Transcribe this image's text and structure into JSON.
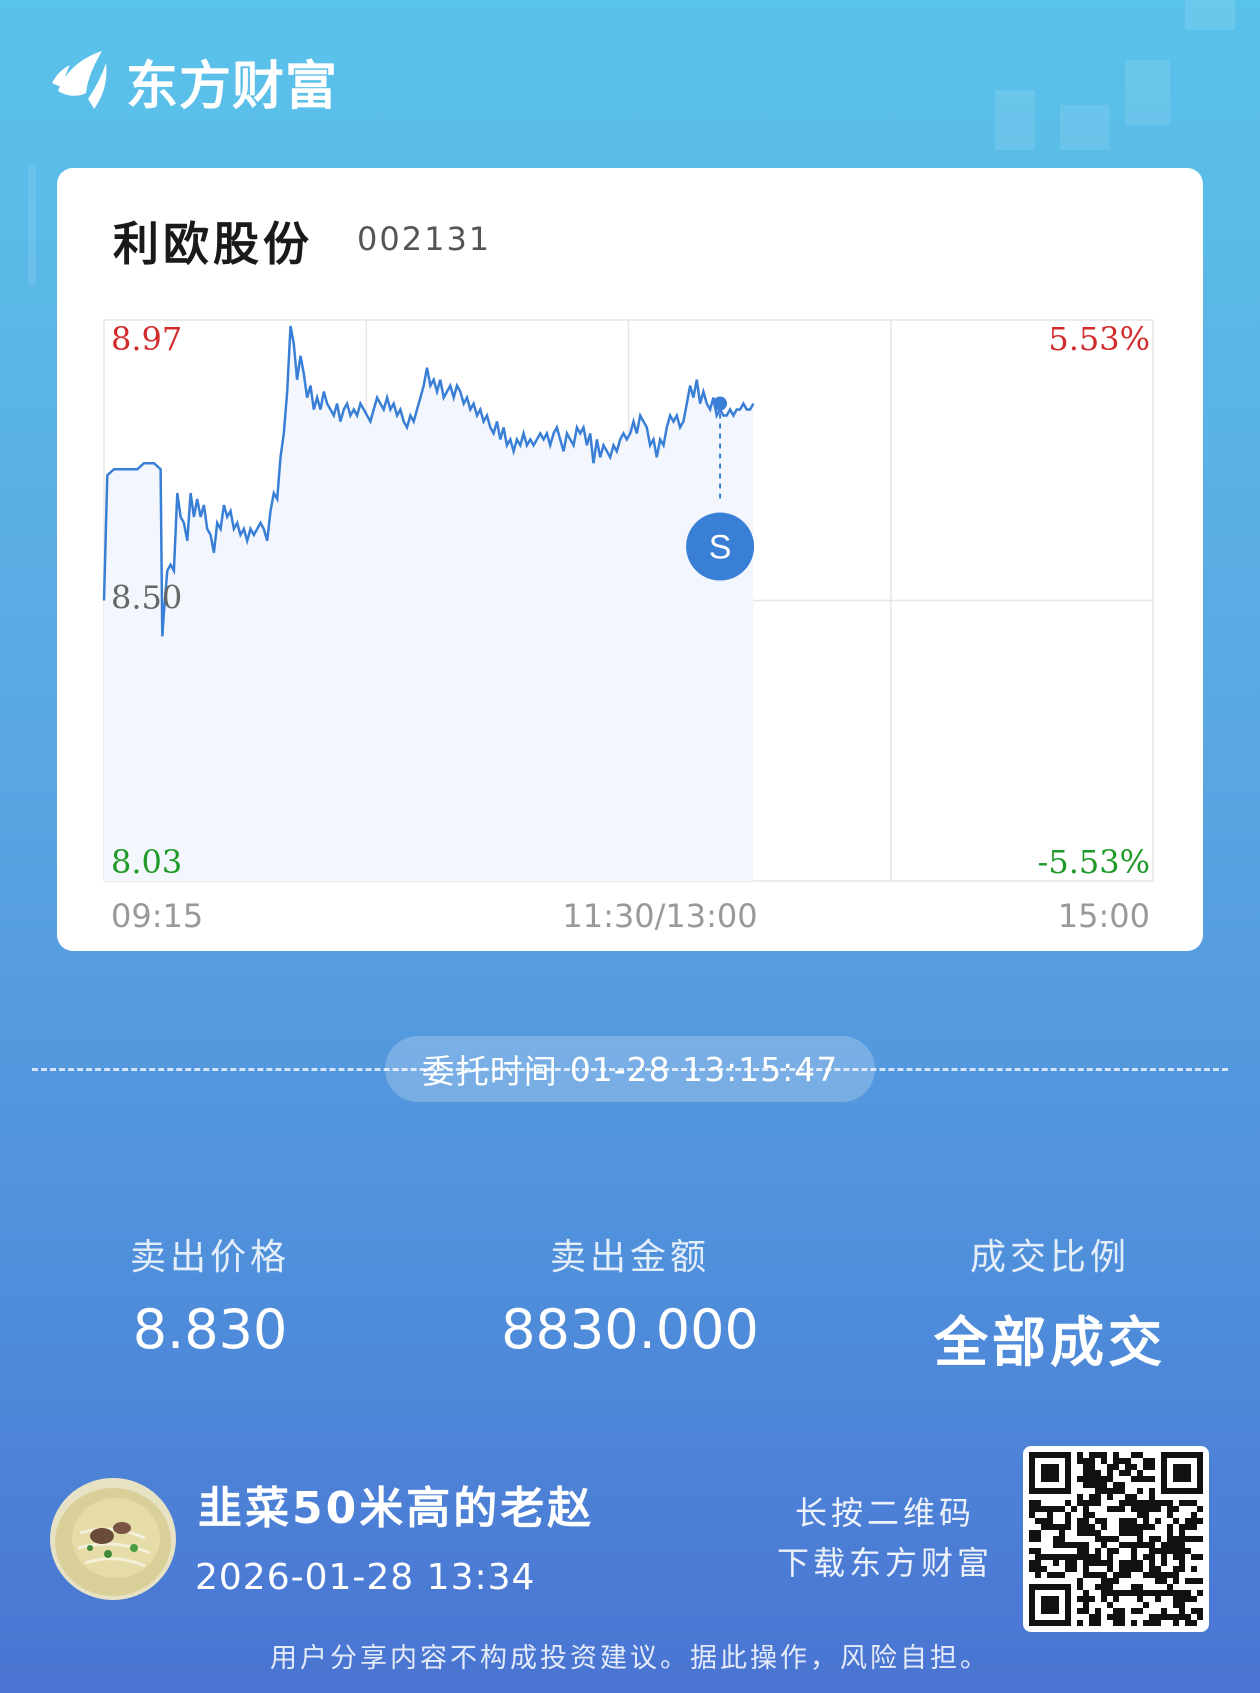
{
  "brand": {
    "name": "东方财富"
  },
  "stock": {
    "name": "利欧股份",
    "code": "002131"
  },
  "chart_data": {
    "type": "line",
    "y_labels": {
      "top": "8.97",
      "mid": "8.50",
      "bottom": "8.03"
    },
    "pct_labels": {
      "top": "5.53%",
      "bottom": "-5.53%"
    },
    "x_labels": {
      "start": "09:15",
      "mid": "11:30/13:00",
      "end": "15:00"
    },
    "ylim": [
      8.03,
      8.97
    ],
    "marker": {
      "label": "S",
      "time": "13:15",
      "price": 8.83
    },
    "series": [
      {
        "values": [
          [
            0,
            8.5
          ],
          [
            1,
            8.71
          ],
          [
            3,
            8.72
          ],
          [
            5,
            8.72
          ],
          [
            7,
            8.72
          ],
          [
            10,
            8.72
          ],
          [
            12,
            8.73
          ],
          [
            15,
            8.73
          ],
          [
            17,
            8.72
          ],
          [
            17.5,
            8.44
          ],
          [
            18,
            8.48
          ],
          [
            19,
            8.55
          ],
          [
            20,
            8.56
          ],
          [
            21,
            8.55
          ],
          [
            22,
            8.68
          ],
          [
            23,
            8.64
          ],
          [
            24,
            8.63
          ],
          [
            25,
            8.6
          ],
          [
            26,
            8.68
          ],
          [
            27,
            8.64
          ],
          [
            28,
            8.67
          ],
          [
            29,
            8.64
          ],
          [
            30,
            8.66
          ],
          [
            31,
            8.62
          ],
          [
            32,
            8.61
          ],
          [
            33,
            8.58
          ],
          [
            34,
            8.63
          ],
          [
            35,
            8.62
          ],
          [
            36,
            8.66
          ],
          [
            37,
            8.64
          ],
          [
            38,
            8.65
          ],
          [
            39,
            8.62
          ],
          [
            40,
            8.63
          ],
          [
            41,
            8.61
          ],
          [
            42,
            8.62
          ],
          [
            43,
            8.6
          ],
          [
            44,
            8.62
          ],
          [
            45,
            8.61
          ],
          [
            46,
            8.62
          ],
          [
            47,
            8.63
          ],
          [
            48,
            8.62
          ],
          [
            49,
            8.6
          ],
          [
            50,
            8.65
          ],
          [
            51,
            8.68
          ],
          [
            52,
            8.67
          ],
          [
            53,
            8.74
          ],
          [
            54,
            8.78
          ],
          [
            55,
            8.85
          ],
          [
            56,
            8.96
          ],
          [
            57,
            8.93
          ],
          [
            58,
            8.87
          ],
          [
            59,
            8.91
          ],
          [
            60,
            8.88
          ],
          [
            61,
            8.84
          ],
          [
            62,
            8.86
          ],
          [
            63,
            8.82
          ],
          [
            64,
            8.84
          ],
          [
            65,
            8.82
          ],
          [
            66,
            8.85
          ],
          [
            67,
            8.83
          ],
          [
            68,
            8.82
          ],
          [
            69,
            8.81
          ],
          [
            70,
            8.83
          ],
          [
            71,
            8.8
          ],
          [
            72,
            8.82
          ],
          [
            73,
            8.83
          ],
          [
            74,
            8.81
          ],
          [
            75,
            8.82
          ],
          [
            76,
            8.81
          ],
          [
            77,
            8.83
          ],
          [
            78,
            8.82
          ],
          [
            79,
            8.81
          ],
          [
            80,
            8.8
          ],
          [
            81,
            8.82
          ],
          [
            82,
            8.84
          ],
          [
            83,
            8.83
          ],
          [
            84,
            8.82
          ],
          [
            85,
            8.84
          ],
          [
            86,
            8.82
          ],
          [
            87,
            8.83
          ],
          [
            88,
            8.81
          ],
          [
            89,
            8.82
          ],
          [
            90,
            8.8
          ],
          [
            91,
            8.79
          ],
          [
            92,
            8.81
          ],
          [
            93,
            8.8
          ],
          [
            94,
            8.82
          ],
          [
            95,
            8.84
          ],
          [
            96,
            8.86
          ],
          [
            97,
            8.89
          ],
          [
            98,
            8.86
          ],
          [
            99,
            8.87
          ],
          [
            100,
            8.85
          ],
          [
            101,
            8.87
          ],
          [
            102,
            8.84
          ],
          [
            103,
            8.85
          ],
          [
            104,
            8.86
          ],
          [
            105,
            8.84
          ],
          [
            106,
            8.86
          ],
          [
            107,
            8.85
          ],
          [
            108,
            8.83
          ],
          [
            109,
            8.84
          ],
          [
            110,
            8.82
          ],
          [
            111,
            8.83
          ],
          [
            112,
            8.81
          ],
          [
            113,
            8.82
          ],
          [
            114,
            8.8
          ],
          [
            115,
            8.81
          ],
          [
            116,
            8.79
          ],
          [
            117,
            8.78
          ],
          [
            118,
            8.8
          ],
          [
            119,
            8.77
          ],
          [
            120,
            8.79
          ],
          [
            121,
            8.76
          ],
          [
            122,
            8.77
          ],
          [
            123,
            8.75
          ],
          [
            124,
            8.77
          ],
          [
            125,
            8.76
          ],
          [
            126,
            8.78
          ],
          [
            127,
            8.76
          ],
          [
            128,
            8.77
          ],
          [
            129,
            8.76
          ],
          [
            130,
            8.77
          ],
          [
            131,
            8.78
          ],
          [
            132,
            8.77
          ],
          [
            133,
            8.78
          ],
          [
            134,
            8.76
          ],
          [
            135,
            8.78
          ],
          [
            136,
            8.79
          ],
          [
            137,
            8.77
          ],
          [
            138,
            8.75
          ],
          [
            139,
            8.78
          ],
          [
            140,
            8.77
          ],
          [
            141,
            8.76
          ],
          [
            142,
            8.79
          ],
          [
            143,
            8.78
          ],
          [
            144,
            8.79
          ],
          [
            145,
            8.76
          ],
          [
            146,
            8.78
          ],
          [
            147,
            8.73
          ],
          [
            148,
            8.77
          ],
          [
            149,
            8.74
          ],
          [
            150,
            8.76
          ],
          [
            151,
            8.75
          ],
          [
            152,
            8.74
          ],
          [
            153,
            8.76
          ],
          [
            154,
            8.75
          ],
          [
            155,
            8.77
          ],
          [
            156,
            8.78
          ],
          [
            157,
            8.77
          ],
          [
            158,
            8.78
          ],
          [
            159,
            8.8
          ],
          [
            160,
            8.78
          ],
          [
            161,
            8.81
          ],
          [
            162,
            8.8
          ],
          [
            163,
            8.79
          ],
          [
            164,
            8.76
          ],
          [
            165,
            8.77
          ],
          [
            166,
            8.74
          ],
          [
            167,
            8.77
          ],
          [
            168,
            8.76
          ],
          [
            169,
            8.79
          ],
          [
            170,
            8.81
          ],
          [
            171,
            8.8
          ],
          [
            172,
            8.81
          ],
          [
            173,
            8.79
          ],
          [
            174,
            8.8
          ],
          [
            175,
            8.83
          ],
          [
            176,
            8.86
          ],
          [
            177,
            8.84
          ],
          [
            178,
            8.87
          ],
          [
            179,
            8.83
          ],
          [
            180,
            8.85
          ],
          [
            181,
            8.83
          ],
          [
            182,
            8.82
          ],
          [
            183,
            8.84
          ],
          [
            184,
            8.81
          ],
          [
            185,
            8.82
          ],
          [
            186,
            8.81
          ],
          [
            187,
            8.81
          ],
          [
            188,
            8.82
          ],
          [
            189,
            8.81
          ],
          [
            190,
            8.82
          ],
          [
            191,
            8.82
          ],
          [
            192,
            8.83
          ],
          [
            193,
            8.82
          ],
          [
            194,
            8.82
          ],
          [
            195,
            8.83
          ]
        ]
      }
    ],
    "x_sessions": {
      "morning_end": 75,
      "afternoon_start": 75,
      "total": 315
    }
  },
  "commission": {
    "label": "委托时间",
    "value": "01-28 13:15:47"
  },
  "stats": [
    {
      "label": "卖出价格",
      "value": "8.830"
    },
    {
      "label": "卖出金额",
      "value": "8830.000"
    },
    {
      "label": "成交比例",
      "value": "全部成交"
    }
  ],
  "user": {
    "name": "韭菜50米高的老赵",
    "time": "2026-01-28 13:34"
  },
  "qr_hint": {
    "line1": "长按二维码",
    "line2": "下载东方财富"
  },
  "disclaimer": "用户分享内容不构成投资建议。据此操作，风险自担。",
  "colors": {
    "up": "#d22b2b",
    "down": "#1f9a2a",
    "line": "#3a7fd6"
  }
}
